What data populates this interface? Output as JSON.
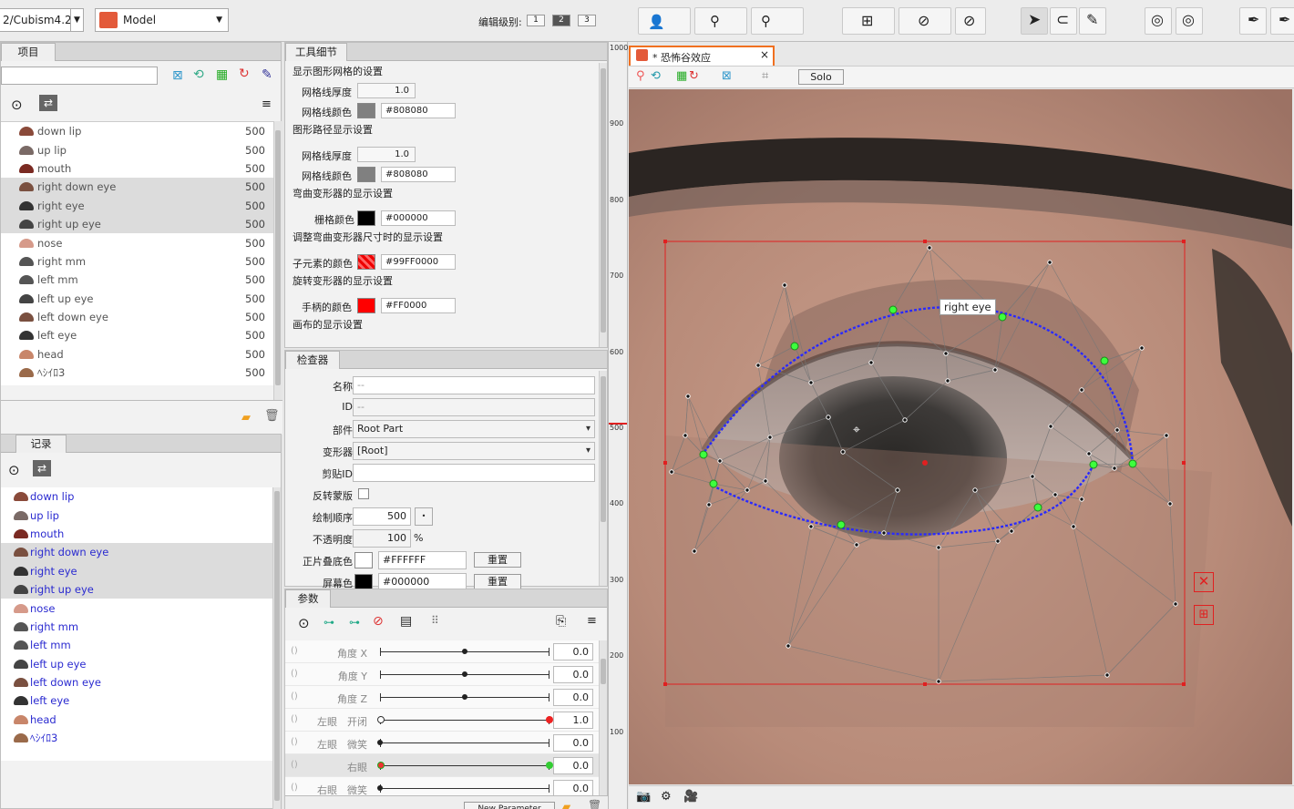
{
  "app": {
    "doc_path": "2/Cubism4.2",
    "mode": "Model",
    "edit_level_label": "编辑级别:",
    "edit_levels": [
      "1",
      "2",
      "3"
    ],
    "active_level": "2"
  },
  "project_panel": {
    "tab": "项目",
    "parts": [
      {
        "name": "down lip",
        "value": "500"
      },
      {
        "name": "up lip",
        "value": "500"
      },
      {
        "name": "mouth",
        "value": "500"
      },
      {
        "name": "right down eye",
        "value": "500"
      },
      {
        "name": "right eye",
        "value": "500"
      },
      {
        "name": "right up eye",
        "value": "500"
      },
      {
        "name": "nose",
        "value": "500"
      },
      {
        "name": "right mm",
        "value": "500"
      },
      {
        "name": "left mm",
        "value": "500"
      },
      {
        "name": "left up eye",
        "value": "500"
      },
      {
        "name": "left down eye",
        "value": "500"
      },
      {
        "name": "left eye",
        "value": "500"
      },
      {
        "name": "head",
        "value": "500"
      },
      {
        "name": "ﾍｼｲﾛ3",
        "value": "500"
      }
    ]
  },
  "history_panel": {
    "tab": "记录",
    "items": [
      "down lip",
      "up lip",
      "mouth",
      "right down eye",
      "right eye",
      "right up eye",
      "nose",
      "right mm",
      "left mm",
      "left up eye",
      "left down eye",
      "left eye",
      "head",
      "ﾍｼｲﾛ3"
    ]
  },
  "tool_details": {
    "tab": "工具细节",
    "sections": {
      "mesh_display": "显示图形网格的设置",
      "mesh_thickness_label": "网格线厚度",
      "mesh_thickness": "1.0",
      "mesh_color_label": "网格线颜色",
      "mesh_color": "#808080",
      "path_display": "图形路径显示设置",
      "path_thickness_label": "网格线厚度",
      "path_thickness": "1.0",
      "path_color_label": "网格线颜色",
      "path_color": "#808080",
      "warp_display": "弯曲变形器的显示设置",
      "grid_color_label": "栅格颜色",
      "grid_color": "#000000",
      "warp_resize": "调整弯曲变形器尺寸时的显示设置",
      "child_color_label": "子元素的颜色",
      "child_color": "#99FF0000",
      "rotation_display": "旋转变形器的显示设置",
      "handle_color_label": "手柄的颜色",
      "handle_color": "#FF0000",
      "canvas_display": "画布的显示设置"
    }
  },
  "inspector": {
    "tab": "检查器",
    "name_label": "名称",
    "name": "--",
    "id_label": "ID",
    "id": "--",
    "part_label": "部件",
    "part": "Root Part",
    "deformer_label": "变形器",
    "deformer": "[Root]",
    "clip_label": "剪贴ID",
    "clip": "",
    "invert_label": "反转蒙版",
    "draw_order_label": "绘制顺序",
    "draw_order": "500",
    "opacity_label": "不透明度",
    "opacity": "100",
    "opacity_unit": "%",
    "multiply_label": "正片叠底色",
    "multiply": "#FFFFFF",
    "screen_label": "屏幕色",
    "screen": "#000000",
    "reset": "重置"
  },
  "parameters": {
    "tab": "参数",
    "new_param": "New Parameter",
    "rows": [
      {
        "label": "角度 X",
        "value": "0.0",
        "pos": 0.5
      },
      {
        "label": "角度 Y",
        "value": "0.0",
        "pos": 0.5
      },
      {
        "label": "角度 Z",
        "value": "0.0",
        "pos": 0.5
      },
      {
        "label": "左眼　开闭",
        "value": "1.0",
        "pos": 1.0
      },
      {
        "label": "左眼　微笑",
        "value": "0.0",
        "pos": 0.0
      },
      {
        "label": "右眼",
        "value": "0.0",
        "pos": 0.0
      },
      {
        "label": "右眼　微笑",
        "value": "0.0",
        "pos": 0.0
      }
    ]
  },
  "canvas": {
    "tab": "* 恐怖谷效应",
    "solo": "Solo",
    "label": "right eye",
    "ruler": [
      "1000",
      "900",
      "800",
      "700",
      "600",
      "500",
      "400",
      "300",
      "200",
      "100"
    ]
  }
}
